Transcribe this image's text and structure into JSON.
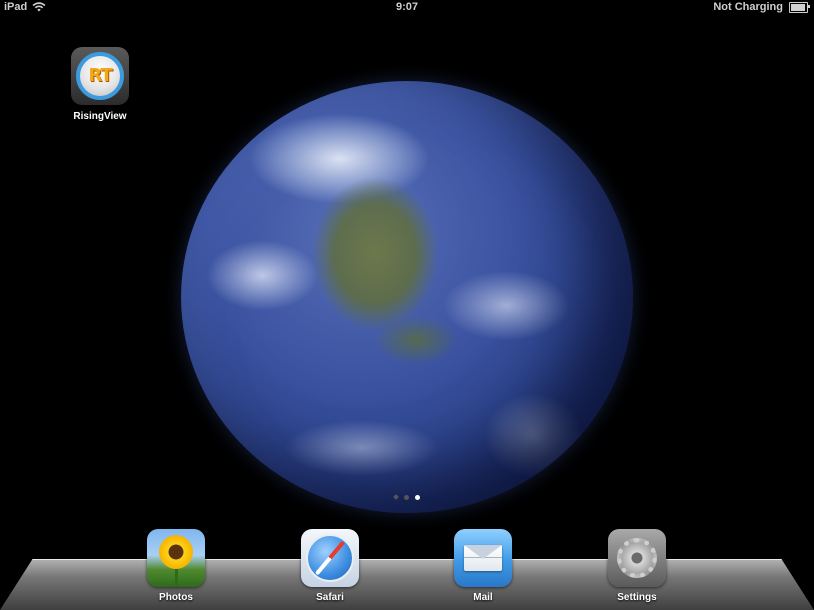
{
  "status_bar": {
    "device": "iPad",
    "time": "9:07",
    "battery_status": "Not Charging",
    "battery_level": 0.95,
    "wifi_icon": "wifi-icon",
    "battery_icon": "battery-icon"
  },
  "wallpaper": {
    "subject": "earth"
  },
  "home_apps": [
    {
      "label": "RisingView",
      "icon": "risingview-icon",
      "icon_text": "RT"
    }
  ],
  "page_indicator": {
    "pages": 3,
    "current_page": 3,
    "search_page": true
  },
  "dock": {
    "apps": [
      {
        "label": "Photos",
        "icon": "photos-icon"
      },
      {
        "label": "Safari",
        "icon": "safari-icon"
      },
      {
        "label": "Mail",
        "icon": "mail-icon"
      },
      {
        "label": "Settings",
        "icon": "settings-icon"
      }
    ]
  },
  "colors": {
    "background": "#000000",
    "status_text": "#cfcfcf",
    "label_text": "#ffffff"
  }
}
